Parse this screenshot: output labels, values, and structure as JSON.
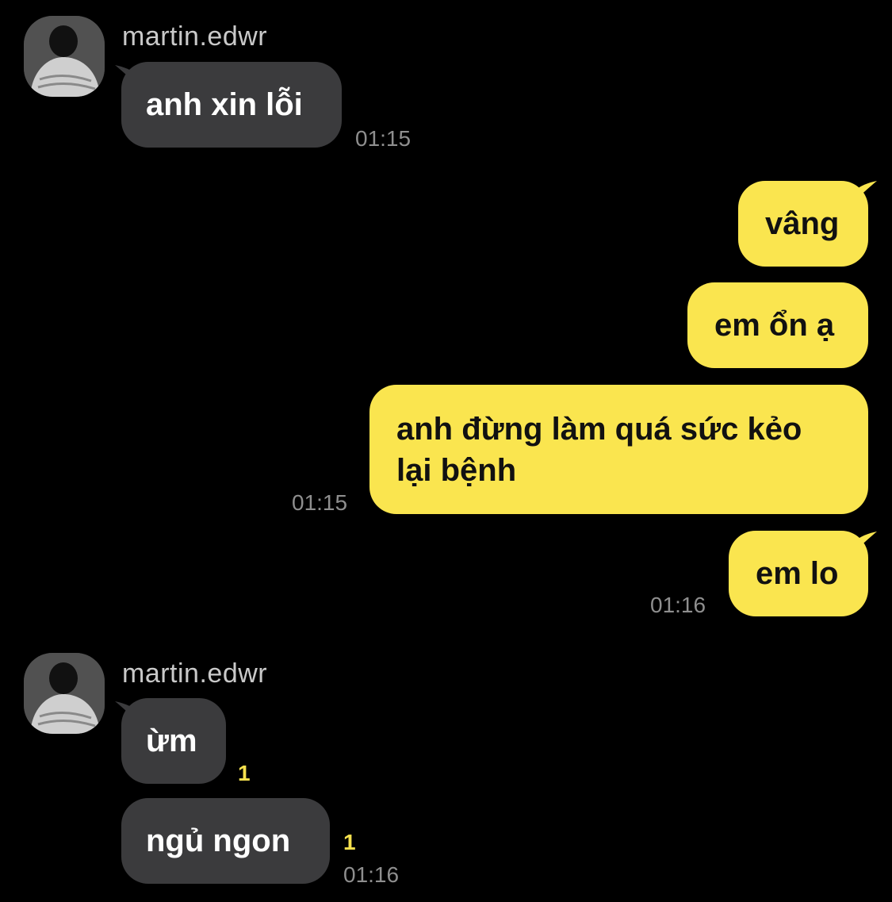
{
  "colors": {
    "background": "#000000",
    "incoming_bubble": "#3b3b3d",
    "outgoing_bubble": "#fae54f",
    "timestamp": "#8e8e8e",
    "unread_count": "#f5e04e"
  },
  "groups": [
    {
      "sender": "martin.edwr",
      "messages": [
        {
          "text": "anh xin lỗi",
          "time": "01:15"
        }
      ]
    },
    {
      "sender": "me",
      "messages": [
        {
          "text": "vâng"
        },
        {
          "text": "em ổn ạ"
        },
        {
          "text": "anh đừng làm quá sức kẻo lại bệnh",
          "time": "01:15"
        },
        {
          "text": "em lo",
          "time": "01:16"
        }
      ]
    },
    {
      "sender": "martin.edwr",
      "messages": [
        {
          "text": "ừm",
          "unread": "1"
        },
        {
          "text": "ngủ ngon",
          "unread": "1",
          "time": "01:16"
        }
      ]
    }
  ]
}
